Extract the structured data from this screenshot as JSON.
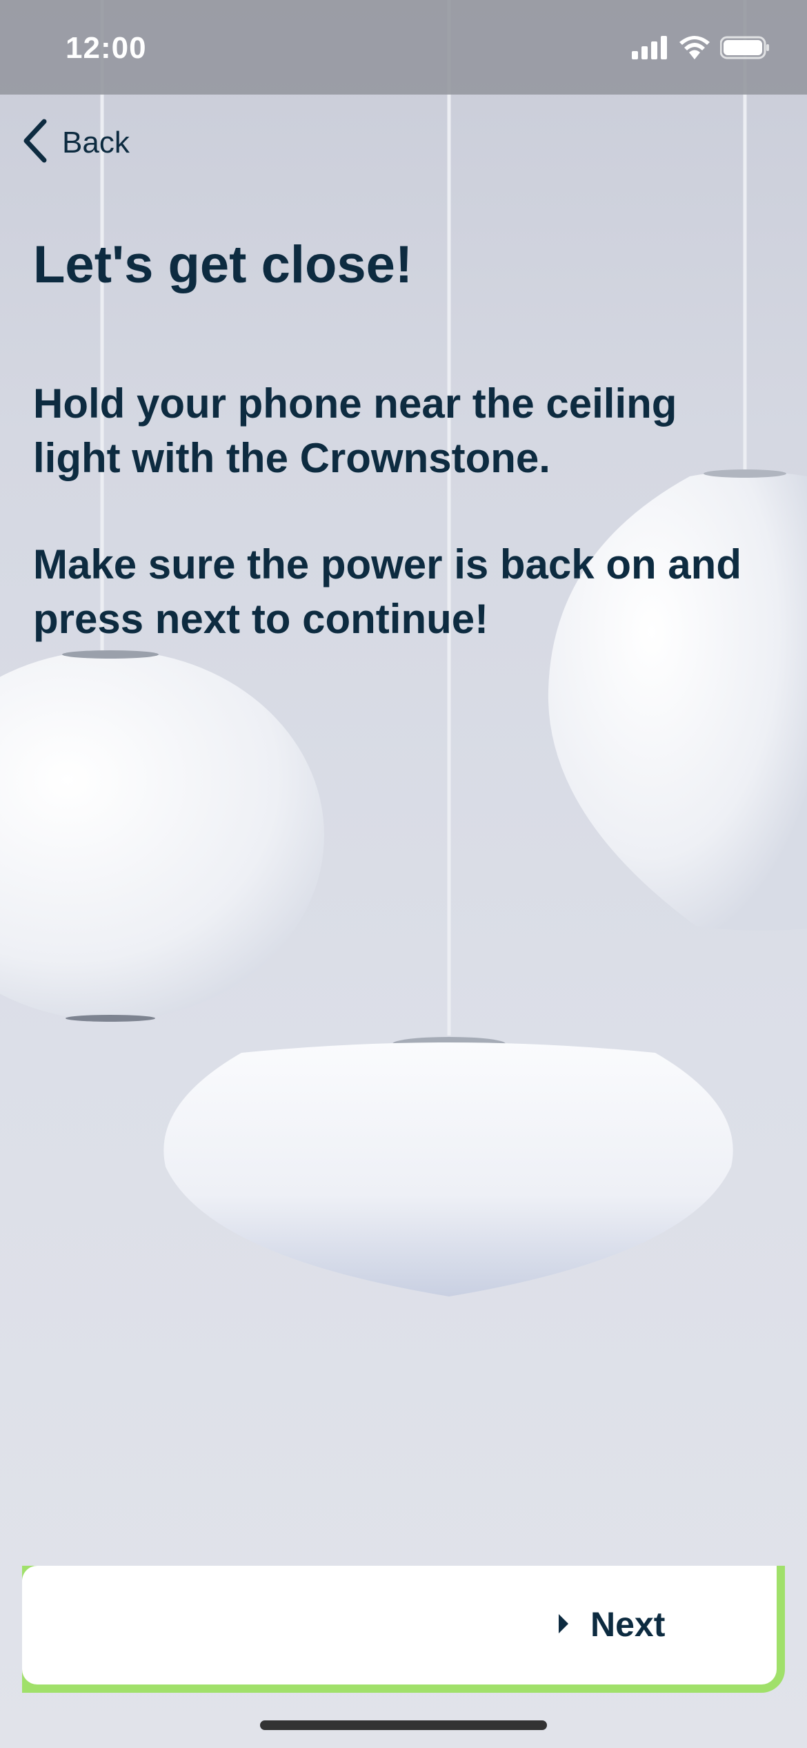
{
  "status_bar": {
    "time": "12:00",
    "icons": [
      "signal-icon",
      "wifi-icon",
      "battery-icon"
    ]
  },
  "nav": {
    "back_label": "Back"
  },
  "content": {
    "title": "Let's get close!",
    "paragraph_1": "Hold your phone near the ceiling light with the Crownstone.",
    "paragraph_2": "Make sure the power is back on and press next to continue!"
  },
  "footer": {
    "next_label": "Next",
    "accent_color": "#a0e06a"
  },
  "colors": {
    "text": "#0d2b40",
    "status_bar": "#9698a0"
  }
}
